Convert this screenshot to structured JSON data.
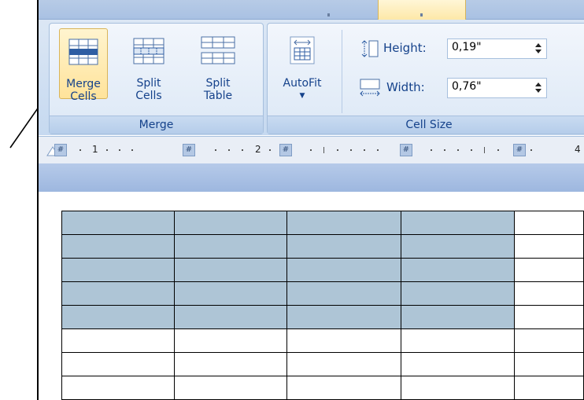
{
  "ribbon": {
    "merge_group": {
      "title": "Merge",
      "merge_cells": {
        "line1": "Merge",
        "line2": "Cells"
      },
      "split_cells": {
        "line1": "Split",
        "line2": "Cells"
      },
      "split_table": {
        "line1": "Split",
        "line2": "Table"
      }
    },
    "cell_size_group": {
      "title": "Cell Size",
      "autofit": {
        "label": "AutoFit",
        "arrow": "▼"
      },
      "height": {
        "label": "Height:",
        "value": "0,19\""
      },
      "width": {
        "label": "Width:",
        "value": "0,76\""
      }
    }
  },
  "ruler": {
    "numbers": [
      "1",
      "2",
      "4"
    ]
  },
  "icons": [
    "merge-cells-icon",
    "split-cells-icon",
    "split-table-icon",
    "autofit-icon",
    "height-icon",
    "width-icon",
    "spinner-icon",
    "table-move-marker-icon"
  ],
  "table": {
    "rows": 8,
    "cols": 5,
    "selected_rows": 5,
    "selected_cols": 4,
    "selection_color": "#aec5d6"
  }
}
